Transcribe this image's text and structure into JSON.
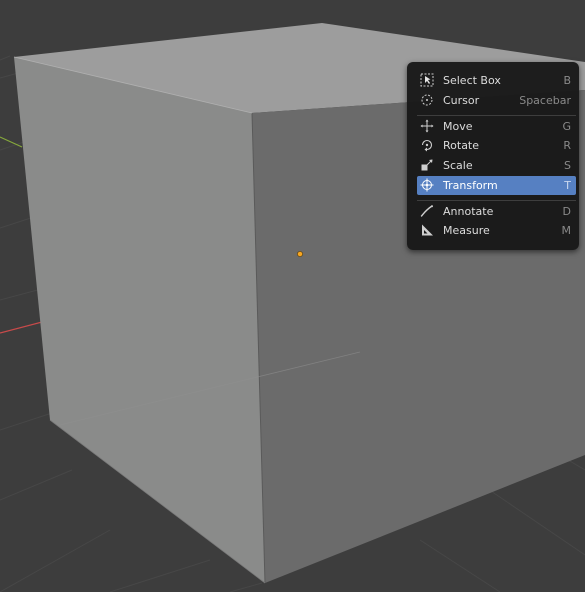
{
  "menu": {
    "items": [
      {
        "label": "Select Box",
        "shortcut": "B",
        "icon": "select-box-icon"
      },
      {
        "label": "Cursor",
        "shortcut": "Spacebar",
        "icon": "cursor-icon"
      },
      {
        "label": "Move",
        "shortcut": "G",
        "icon": "move-icon"
      },
      {
        "label": "Rotate",
        "shortcut": "R",
        "icon": "rotate-icon"
      },
      {
        "label": "Scale",
        "shortcut": "S",
        "icon": "scale-icon"
      },
      {
        "label": "Transform",
        "shortcut": "T",
        "icon": "transform-icon",
        "active": true
      },
      {
        "label": "Annotate",
        "shortcut": "D",
        "icon": "annotate-icon"
      },
      {
        "label": "Measure",
        "shortcut": "M",
        "icon": "measure-icon"
      }
    ]
  },
  "colors": {
    "viewport_bg": "#3d3d3d",
    "highlight": "#5680c2",
    "x_axis": "#c84a4a",
    "y_axis": "#86a83c",
    "origin_dot": "#f5a623"
  }
}
